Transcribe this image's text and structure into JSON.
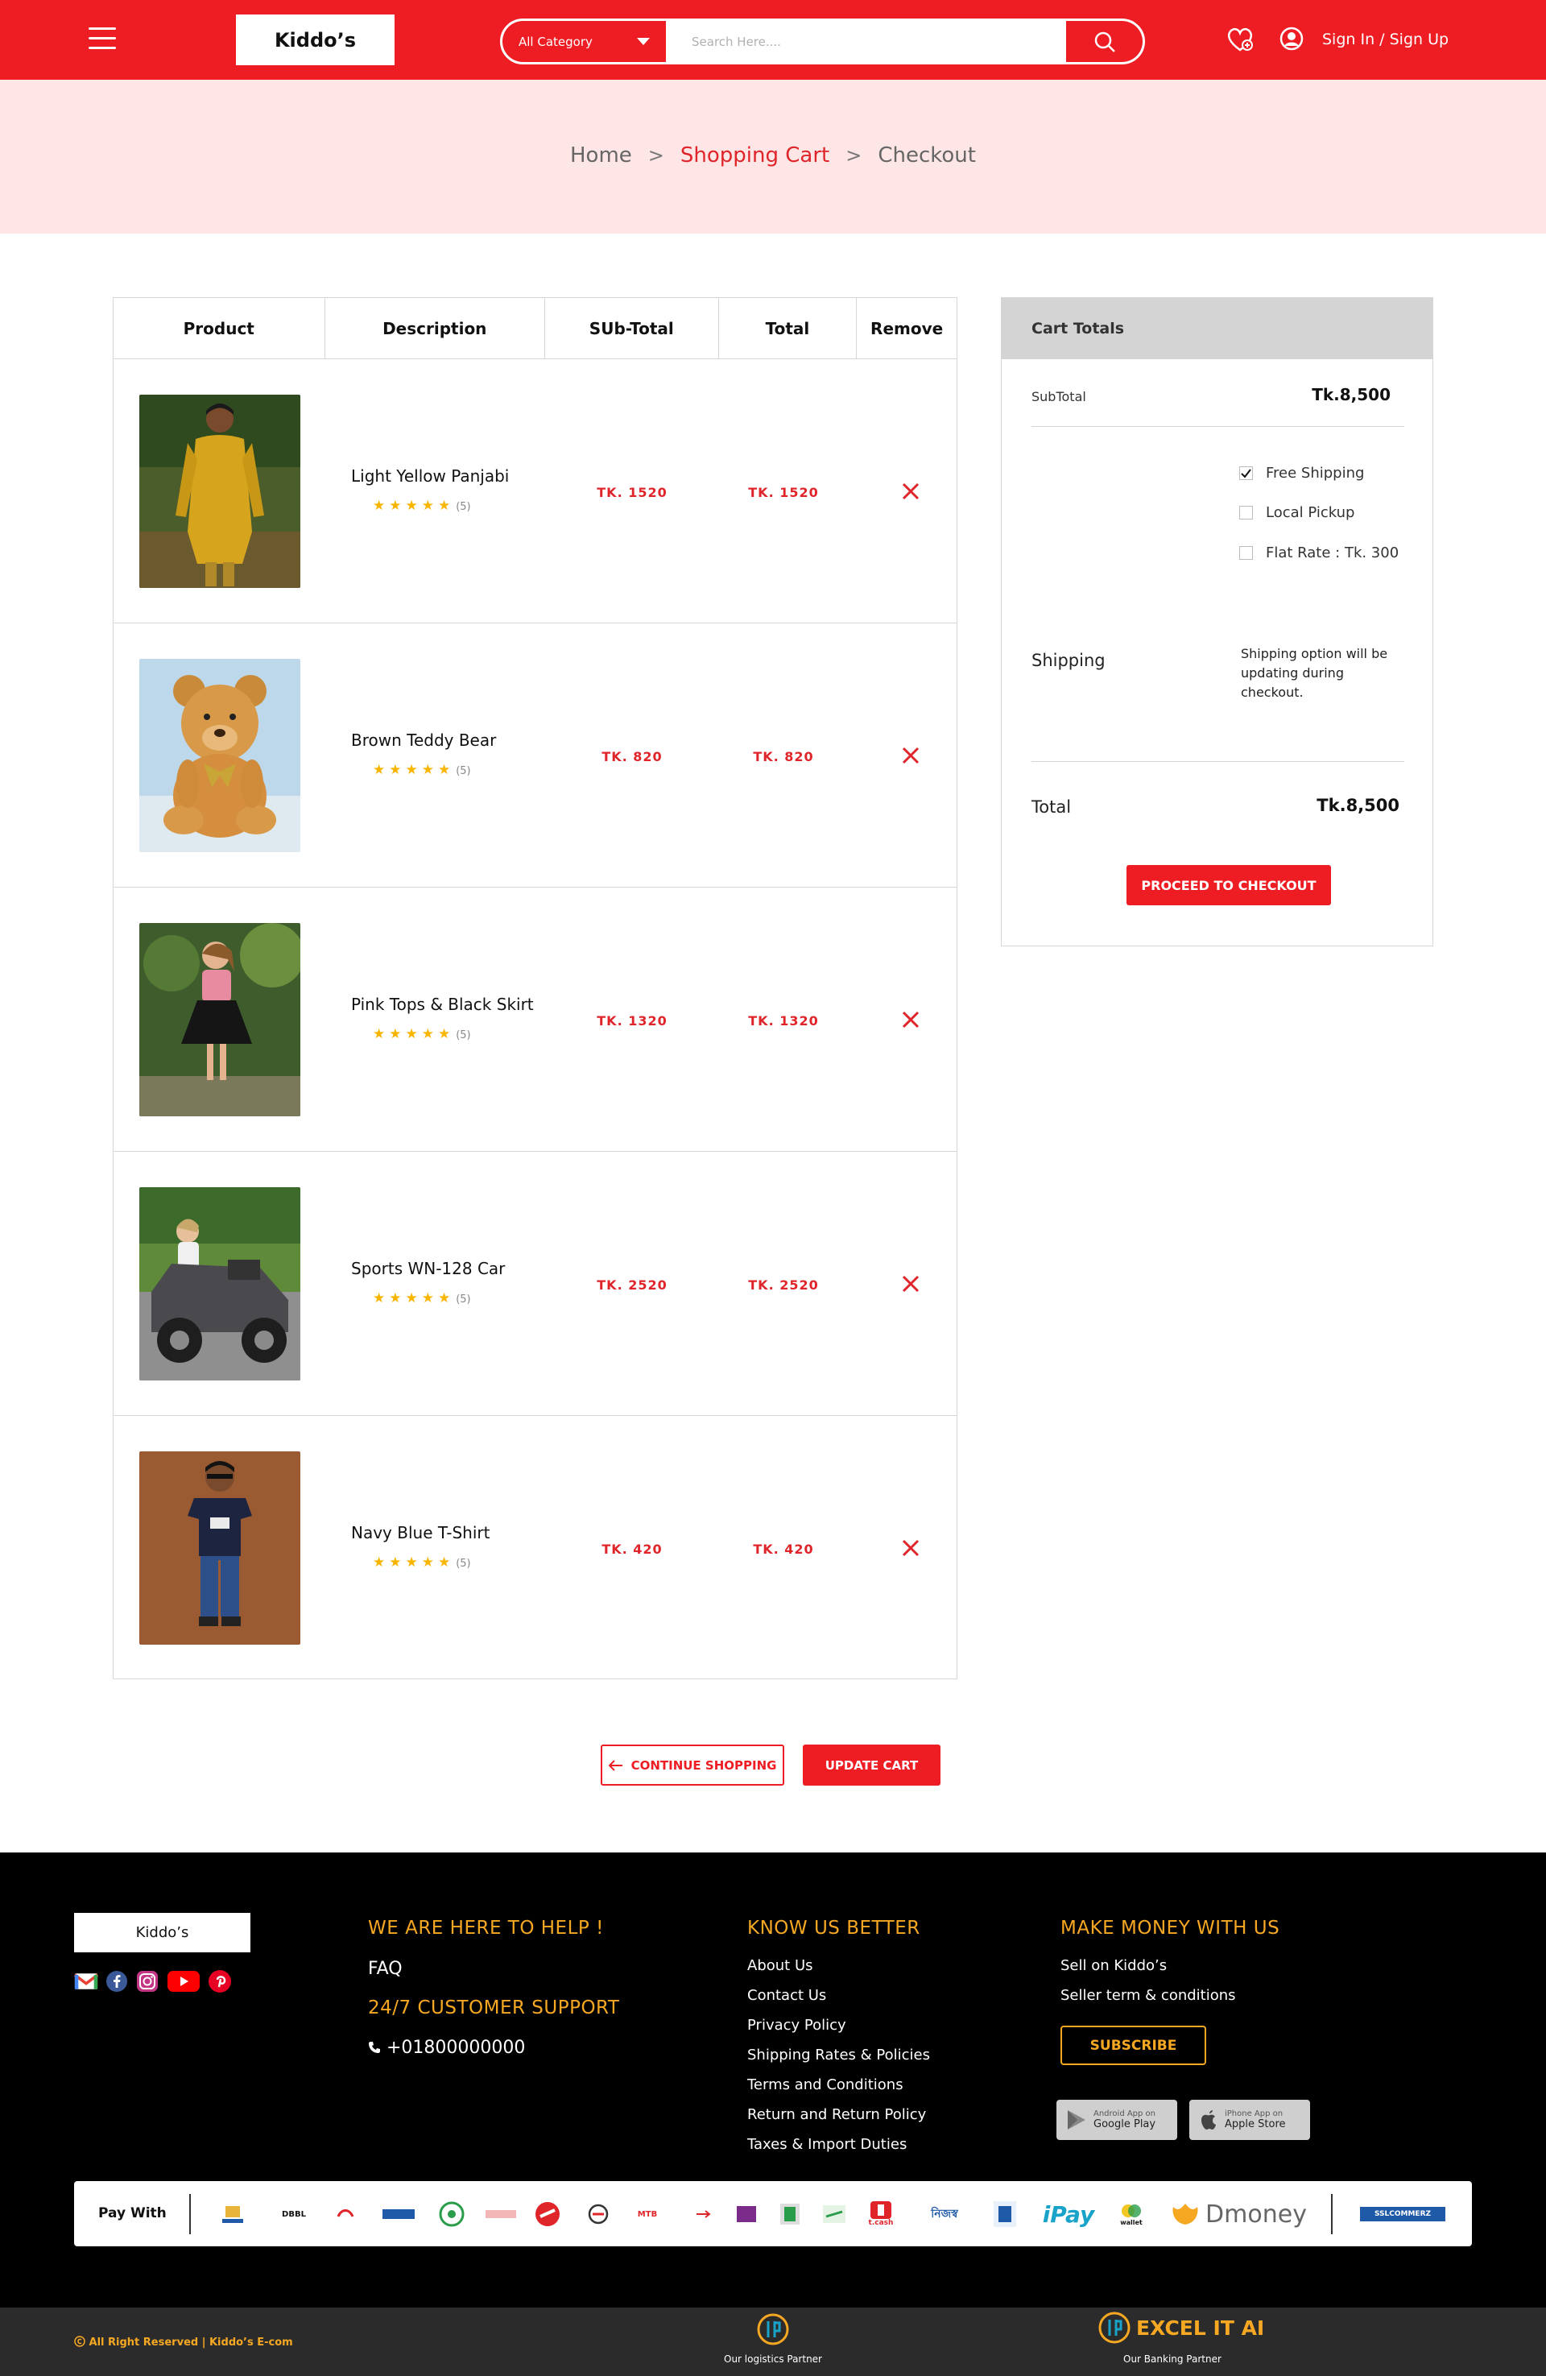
{
  "header": {
    "logo": "Kiddo’s",
    "search": {
      "category": "All Category",
      "placeholder": "Search Here...."
    },
    "sign_in": "Sign In / Sign Up",
    "colors": {
      "brand_red": "#ee1d23",
      "accent_orange": "#f7a823"
    }
  },
  "breadcrumb": {
    "home": "Home",
    "cart": "Shopping Cart",
    "checkout": "Checkout",
    "separator": ">"
  },
  "cart": {
    "headers": {
      "product": "Product",
      "description": "Description",
      "subtotal": "SUb-Total",
      "total": "Total",
      "remove": "Remove"
    },
    "items": [
      {
        "name": "Light Yellow Panjabi",
        "rating": 5,
        "stars": "★★★★★",
        "reviews": "(5)",
        "subtotal": "TK. 1520",
        "total": "TK. 1520",
        "image": "boy-yellow-panjabi"
      },
      {
        "name": "Brown Teddy Bear",
        "rating": 5,
        "stars": "★★★★★",
        "reviews": "(5)",
        "subtotal": "TK. 820",
        "total": "TK. 820",
        "image": "brown-teddy-bear"
      },
      {
        "name": "Pink Tops & Black Skirt",
        "rating": 5,
        "stars": "★★★★★",
        "reviews": "(5)",
        "subtotal": "TK. 1320",
        "total": "TK. 1320",
        "image": "girl-pink-top-black-skirt"
      },
      {
        "name": "Sports WN-128 Car",
        "rating": 5,
        "stars": "★★★★★",
        "reviews": "(5)",
        "subtotal": "TK. 2520",
        "total": "TK. 2520",
        "image": "kid-ride-on-car"
      },
      {
        "name": "Navy Blue T-Shirt",
        "rating": 5,
        "stars": "★★★★★",
        "reviews": "(5)",
        "subtotal": "TK. 420",
        "total": "TK. 420",
        "image": "boy-navy-tshirt"
      }
    ]
  },
  "totals": {
    "title": "Cart Totals",
    "subtotal_label": "SubTotal",
    "subtotal_value": "Tk.8,500",
    "shipping_options": [
      {
        "label": "Free Shipping",
        "checked": true
      },
      {
        "label": "Local Pickup",
        "checked": false
      },
      {
        "label": "Flat Rate : Tk. 300",
        "checked": false
      }
    ],
    "shipping_label": "Shipping",
    "shipping_note": "Shipping option will be updating during checkout.",
    "total_label": "Total",
    "total_value": "Tk.8,500",
    "checkout_button": "PROCEED TO CHECKOUT"
  },
  "actions": {
    "continue": "CONTINUE SHOPPING",
    "update": "UPDATE CART"
  },
  "footer": {
    "logo": "Kiddo’s",
    "help_heading": "WE ARE HERE TO HELP !",
    "faq": "FAQ",
    "support_heading": "24/7 CUSTOMER SUPPORT",
    "phone": "+01800000000",
    "know_heading": "KNOW US BETTER",
    "know_links": [
      "About Us",
      "Contact Us",
      "Privacy Policy",
      "Shipping Rates & Policies",
      "Terms and Conditions",
      "Return and Return Policy",
      "Taxes & Import Duties"
    ],
    "money_heading": "MAKE MONEY WITH US",
    "money_links": [
      "Sell on Kiddo’s",
      "Seller term & conditions"
    ],
    "subscribe": "SUBSCRIBE",
    "google_play": {
      "top": "Android App on",
      "bottom": "Google Play"
    },
    "apple_store": {
      "top": "iPhone App on",
      "bottom": "Apple Store"
    },
    "pay_with": "Pay With",
    "pay_logos": [
      "DBBL",
      "MTB",
      "t.cash",
      "নিজস্ব",
      "iPay",
      "wallet",
      "Dmoney",
      "SSLCOMMERZ"
    ],
    "copyright": "All Right Reserved | Kiddo’s E-com",
    "logistics_caption": "Our logistics Partner",
    "banking_caption": "Our Banking Partner",
    "banking_brand": "EXCEL IT AI"
  }
}
